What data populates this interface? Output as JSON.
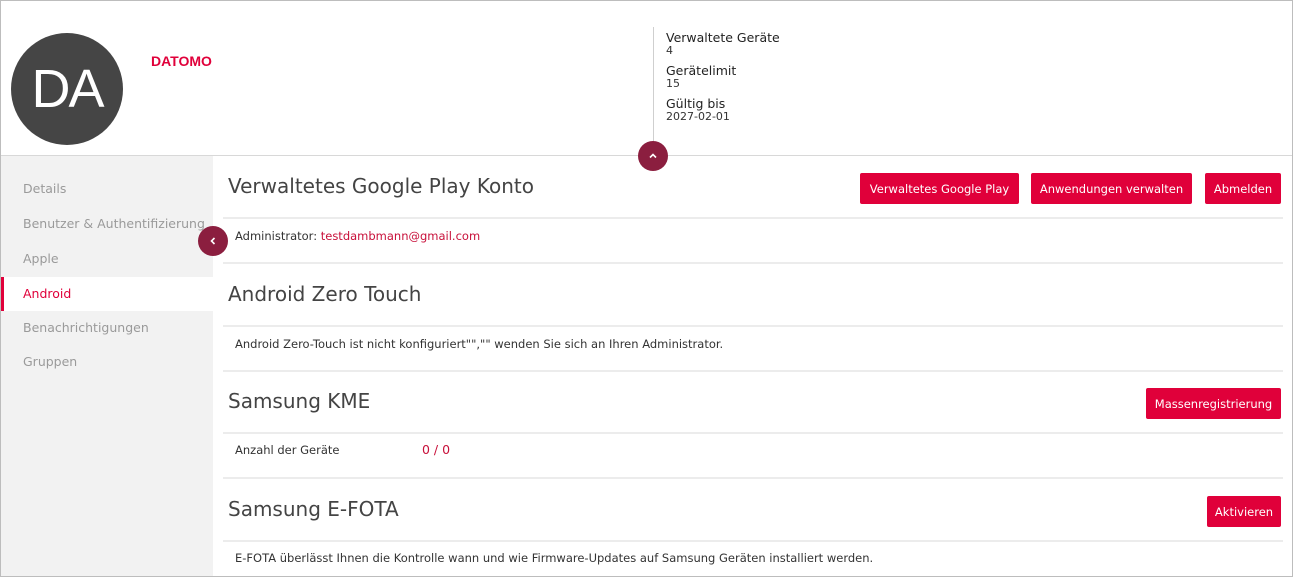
{
  "header": {
    "avatar_initials": "DA",
    "company_name": "DATOMO",
    "stats": [
      {
        "label": "Verwaltete Geräte",
        "value": "4"
      },
      {
        "label": "Gerätelimit",
        "value": "15"
      },
      {
        "label": "Gültig bis",
        "value": "2027-02-01"
      }
    ]
  },
  "sidebar": {
    "items": [
      {
        "label": "Details",
        "active": false
      },
      {
        "label": "Benutzer & Authentifizierung",
        "active": false
      },
      {
        "label": "Apple",
        "active": false
      },
      {
        "label": "Android",
        "active": true
      },
      {
        "label": "Benachrichtigungen",
        "active": false
      },
      {
        "label": "Gruppen",
        "active": false
      }
    ]
  },
  "sections": {
    "google_play": {
      "title": "Verwaltetes Google Play Konto",
      "buttons": [
        "Verwaltetes Google Play",
        "Anwendungen verwalten",
        "Abmelden"
      ],
      "admin_label": "Administrator:",
      "admin_email": "testdambmann@gmail.com"
    },
    "zero_touch": {
      "title": "Android Zero Touch",
      "text": "Android Zero-Touch ist nicht konfiguriert\"\",\"\" wenden Sie sich an Ihren Administrator."
    },
    "samsung_kme": {
      "title": "Samsung KME",
      "button": "Massenregistrierung",
      "count_label": "Anzahl der Geräte",
      "count_value": "0 / 0"
    },
    "samsung_efota": {
      "title": "Samsung E-FOTA",
      "button": "Aktivieren",
      "text": "E-FOTA überlässt Ihnen die Kontrolle wann und wie Firmware-Updates auf Samsung Geräten installiert werden."
    }
  },
  "colors": {
    "accent": "#e0003a",
    "toggle": "#8b1e3f",
    "sidebar_bg": "#f2f2f2"
  },
  "icons": {
    "collapse_up": "chevron-up-icon",
    "collapse_left": "chevron-left-icon"
  }
}
